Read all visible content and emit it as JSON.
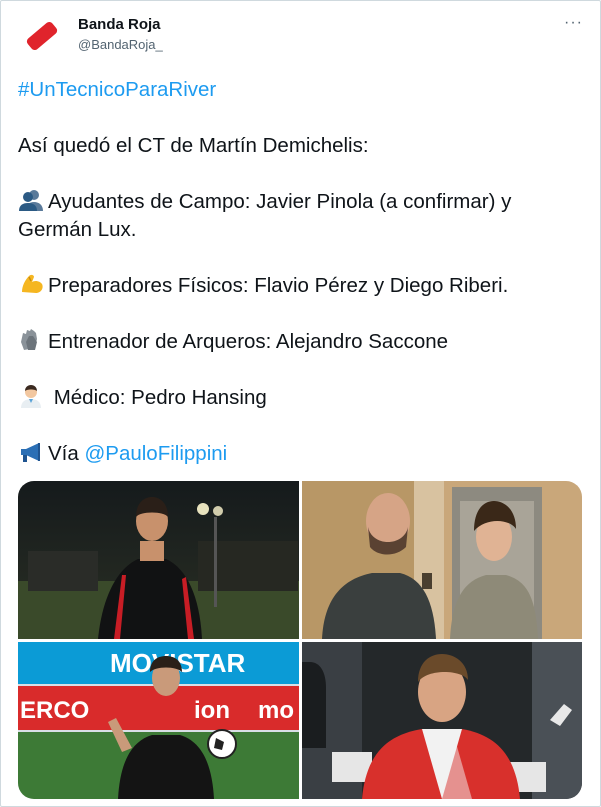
{
  "author": {
    "name": "Banda Roja",
    "handle": "@BandaRoja_"
  },
  "menu": {
    "icon": "more-horizontal-icon",
    "label": "···"
  },
  "tweet": {
    "hashtag": "#UnTecnicoParaRiver",
    "intro": "Así quedó el CT de Martín Demichelis:",
    "line1": "Ayudantes de Campo: Javier Pinola (a confirmar) y Germán Lux.",
    "line2": "Preparadores Físicos: Flavio Pérez y Diego Riberi.",
    "line3": "Entrenador de Arqueros: Alejandro Saccone",
    "line4": " Médico: Pedro Hansing",
    "via_prefix": "Vía ",
    "via_mention": "@PauloFilippini"
  },
  "emojis": {
    "line1": "busts-in-silhouette-icon",
    "line2": "flexed-biceps-icon",
    "line3": "gloves-icon",
    "line4": "health-worker-icon",
    "via": "megaphone-icon"
  },
  "media": {
    "photos": [
      {
        "description": "coach in black training jacket on pitch at night"
      },
      {
        "description": "two men talking in elevator lobby"
      },
      {
        "description": "man in black shirt holding football, sponsor boards behind"
      },
      {
        "description": "man in red River Plate jacket speaking to press"
      }
    ],
    "ad_boards": {
      "top_left": "MOVISTAR",
      "mid_left": "ERCO",
      "mid_mid": "ion",
      "mid_right": "mo"
    }
  },
  "colors": {
    "accent": "#1d9bf0",
    "text": "#0f1419",
    "secondary": "#536471",
    "brand_red": "#e0242c"
  }
}
